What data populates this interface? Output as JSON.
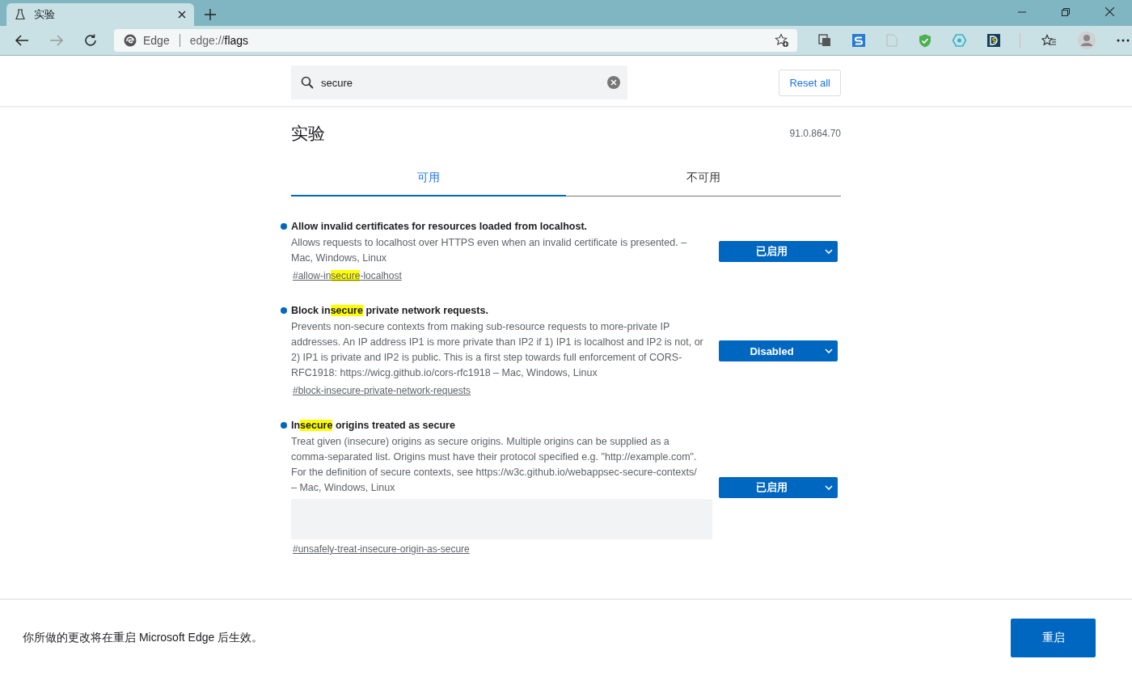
{
  "browser": {
    "tab": {
      "title": "实验",
      "selected": true
    },
    "address": {
      "site_label": "Edge",
      "url_prefix": "edge://",
      "url_host": "flags"
    }
  },
  "search": {
    "value": "secure"
  },
  "reset_button": "Reset all",
  "page": {
    "title": "实验",
    "version": "91.0.864.70"
  },
  "tabs": [
    {
      "label": "可用",
      "selected": true
    },
    {
      "label": "不可用",
      "selected": false
    }
  ],
  "flags": [
    {
      "title": [
        {
          "text": "Allow invalid certificates for resources loaded from localhost.",
          "highlight": false
        }
      ],
      "description": "Allows requests to localhost over HTTPS even when an invalid certificate is presented. – Mac, Windows, Linux",
      "link": [
        {
          "text": "#allow-in",
          "highlight": false
        },
        {
          "text": "secure",
          "highlight": true
        },
        {
          "text": "-localhost",
          "highlight": false
        }
      ],
      "value": "已启用",
      "kind": "toggle"
    },
    {
      "title": [
        {
          "text": "Block in",
          "highlight": false
        },
        {
          "text": "secure",
          "highlight": true
        },
        {
          "text": " private network requests.",
          "highlight": false
        }
      ],
      "description": "Prevents non-secure contexts from making sub-resource requests to more-private IP addresses. An IP address IP1 is more private than IP2 if 1) IP1 is localhost and IP2 is not, or 2) IP1 is private and IP2 is public. This is a first step towards full enforcement of CORS-RFC1918: https://wicg.github.io/cors-rfc1918 – Mac, Windows, Linux",
      "link": [
        {
          "text": "#block-insecure-private-network-requests",
          "highlight": false
        }
      ],
      "value": "Disabled",
      "kind": "toggle"
    },
    {
      "title": [
        {
          "text": "In",
          "highlight": false
        },
        {
          "text": "secure",
          "highlight": true
        },
        {
          "text": " origins treated as secure",
          "highlight": false
        }
      ],
      "description": "Treat given (insecure) origins as secure origins. Multiple origins can be supplied as a comma-separated list. Origins must have their protocol specified e.g. \"http://example.com\". For the definition of secure contexts, see https://w3c.github.io/webappsec-secure-contexts/ – Mac, Windows, Linux",
      "link": [
        {
          "text": "#unsafely-treat-insecure-origin-as-secure",
          "highlight": false
        }
      ],
      "value": "已启用",
      "kind": "origin-list"
    }
  ],
  "footer": {
    "message": "你所做的更改将在重启 Microsoft Edge 后生效。",
    "button": "重启"
  }
}
